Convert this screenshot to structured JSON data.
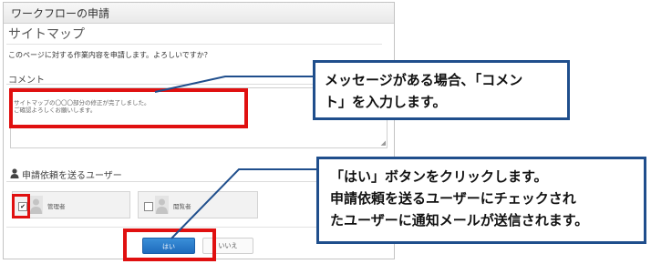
{
  "dialog": {
    "title": "ワークフローの申請",
    "page_title": "サイトマップ",
    "confirm_text": "このページに対する作業内容を申請します。よろしいですか？",
    "comment_label": "コメント",
    "comment_value": "サイトマップの〇〇〇部分の修正が完了しました。\nご確認よろしくお願いします。",
    "users_heading": "申請依頼を送るユーザー",
    "users": [
      {
        "name": "管理者",
        "checked": true
      },
      {
        "name": "閲覧者",
        "checked": false
      }
    ],
    "checkmark": "✔",
    "yes_label": "はい",
    "no_label": "いいえ",
    "resize_grip": "◢"
  },
  "callouts": {
    "comment": [
      "メッセージがある場合､「コメン",
      "ト」を入力します。"
    ],
    "yes": [
      "「はい」ボタンをクリックします。",
      "申請依頼を送るユーザーにチェックされ",
      "たユーザーに通知メールが送信されます。"
    ]
  },
  "colors": {
    "highlight": "#e01010",
    "callout_border": "#1f4e8c",
    "primary_button": "#1f6bbd"
  }
}
